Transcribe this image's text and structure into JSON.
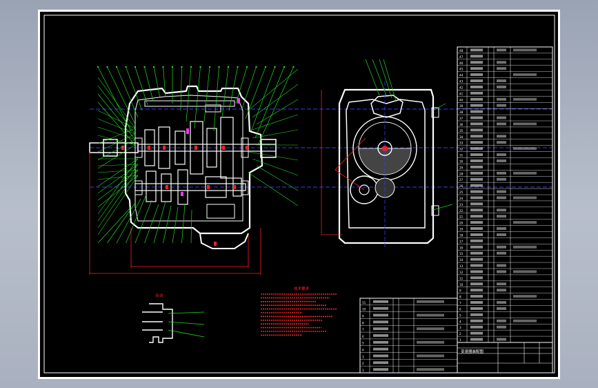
{
  "colors": {
    "background": "#000000",
    "frame": "#ffffff",
    "outline": "#ffffff",
    "centerline": "#3a3aff",
    "leader": "#22dd22",
    "dimension": "#ff2020",
    "highlight": "#ff33ff"
  },
  "drawing": {
    "section_label": "B-B"
  },
  "technical_requirements": {
    "title": "技术要求"
  },
  "parts_list_right": {
    "row_numbers": [
      "48",
      "47",
      "46",
      "45",
      "44",
      "43",
      "42",
      "41",
      "40",
      "39",
      "38",
      "37",
      "36",
      "35",
      "34",
      "33",
      "32",
      "31",
      "30",
      "29",
      "28",
      "27",
      "26",
      "25",
      "24",
      "23",
      "22",
      "21",
      "20",
      "19",
      "18",
      "17",
      "16",
      "15",
      "14",
      "13",
      "12",
      "11",
      "10",
      "9",
      "8",
      "7",
      "6",
      "5",
      "4",
      "3",
      "2",
      "1"
    ]
  },
  "parts_list_left": {
    "row_numbers": [
      "11",
      "10",
      "9",
      "8",
      "7",
      "6",
      "5",
      "4",
      "3",
      "2",
      "1"
    ]
  },
  "title_block": {
    "name": "变速器装配图"
  }
}
